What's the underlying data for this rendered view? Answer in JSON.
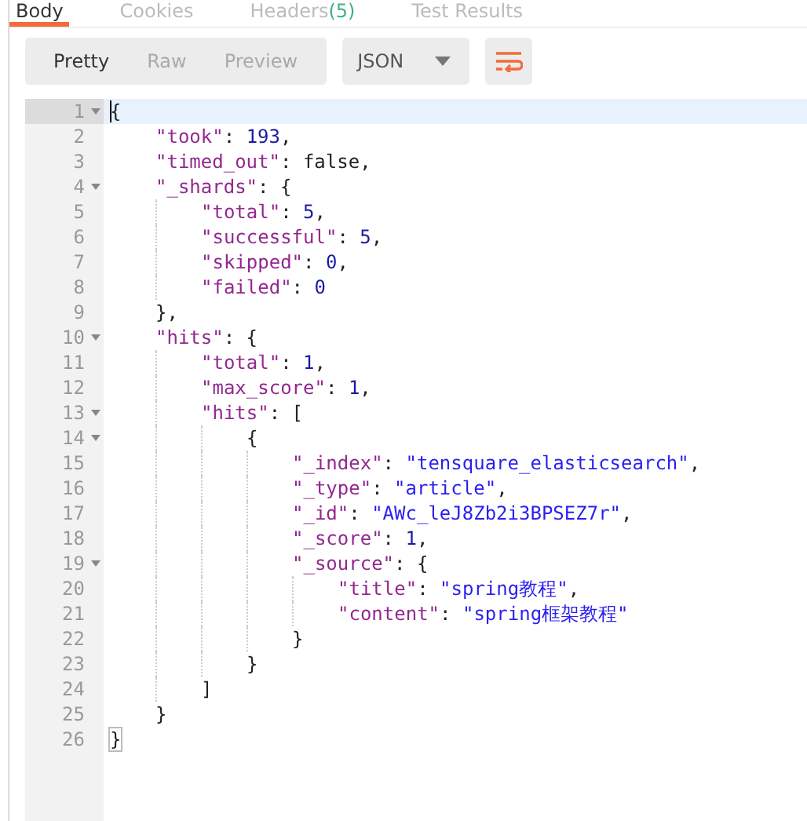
{
  "tabs": [
    {
      "label": "Body",
      "selected": true
    },
    {
      "label": "Cookies",
      "selected": false
    },
    {
      "label": "Headers",
      "count": "(5)",
      "selected": false
    },
    {
      "label": "Test Results",
      "selected": false
    }
  ],
  "view_modes": [
    {
      "label": "Pretty",
      "selected": true
    },
    {
      "label": "Raw",
      "selected": false
    },
    {
      "label": "Preview",
      "selected": false
    }
  ],
  "format_dropdown": {
    "value": "JSON"
  },
  "editor": {
    "lines": [
      {
        "number": "1",
        "fold": true,
        "active": true,
        "tokens": [
          {
            "kind": "punct",
            "text": "{"
          }
        ]
      },
      {
        "number": "2",
        "fold": false,
        "active": false,
        "tokens": [
          {
            "kind": "key",
            "text": "\"took\""
          },
          {
            "kind": "punct",
            "text": ": "
          },
          {
            "kind": "number",
            "text": "193"
          },
          {
            "kind": "punct",
            "text": ","
          }
        ]
      },
      {
        "number": "3",
        "fold": false,
        "active": false,
        "tokens": [
          {
            "kind": "key",
            "text": "\"timed_out\""
          },
          {
            "kind": "punct",
            "text": ": "
          },
          {
            "kind": "bool",
            "text": "false"
          },
          {
            "kind": "punct",
            "text": ","
          }
        ]
      },
      {
        "number": "4",
        "fold": true,
        "active": false,
        "tokens": [
          {
            "kind": "key",
            "text": "\"_shards\""
          },
          {
            "kind": "punct",
            "text": ": {"
          }
        ]
      },
      {
        "number": "5",
        "fold": false,
        "active": false,
        "tokens": [
          {
            "kind": "key",
            "text": "\"total\""
          },
          {
            "kind": "punct",
            "text": ": "
          },
          {
            "kind": "number",
            "text": "5"
          },
          {
            "kind": "punct",
            "text": ","
          }
        ]
      },
      {
        "number": "6",
        "fold": false,
        "active": false,
        "tokens": [
          {
            "kind": "key",
            "text": "\"successful\""
          },
          {
            "kind": "punct",
            "text": ": "
          },
          {
            "kind": "number",
            "text": "5"
          },
          {
            "kind": "punct",
            "text": ","
          }
        ]
      },
      {
        "number": "7",
        "fold": false,
        "active": false,
        "tokens": [
          {
            "kind": "key",
            "text": "\"skipped\""
          },
          {
            "kind": "punct",
            "text": ": "
          },
          {
            "kind": "number",
            "text": "0"
          },
          {
            "kind": "punct",
            "text": ","
          }
        ]
      },
      {
        "number": "8",
        "fold": false,
        "active": false,
        "tokens": [
          {
            "kind": "key",
            "text": "\"failed\""
          },
          {
            "kind": "punct",
            "text": ": "
          },
          {
            "kind": "number",
            "text": "0"
          }
        ]
      },
      {
        "number": "9",
        "fold": false,
        "active": false,
        "tokens": [
          {
            "kind": "punct",
            "text": "},"
          }
        ]
      },
      {
        "number": "10",
        "fold": true,
        "active": false,
        "tokens": [
          {
            "kind": "key",
            "text": "\"hits\""
          },
          {
            "kind": "punct",
            "text": ": {"
          }
        ]
      },
      {
        "number": "11",
        "fold": false,
        "active": false,
        "tokens": [
          {
            "kind": "key",
            "text": "\"total\""
          },
          {
            "kind": "punct",
            "text": ": "
          },
          {
            "kind": "number",
            "text": "1"
          },
          {
            "kind": "punct",
            "text": ","
          }
        ]
      },
      {
        "number": "12",
        "fold": false,
        "active": false,
        "tokens": [
          {
            "kind": "key",
            "text": "\"max_score\""
          },
          {
            "kind": "punct",
            "text": ": "
          },
          {
            "kind": "number",
            "text": "1"
          },
          {
            "kind": "punct",
            "text": ","
          }
        ]
      },
      {
        "number": "13",
        "fold": true,
        "active": false,
        "tokens": [
          {
            "kind": "key",
            "text": "\"hits\""
          },
          {
            "kind": "punct",
            "text": ": ["
          }
        ]
      },
      {
        "number": "14",
        "fold": true,
        "active": false,
        "tokens": [
          {
            "kind": "punct",
            "text": "{"
          }
        ]
      },
      {
        "number": "15",
        "fold": false,
        "active": false,
        "tokens": [
          {
            "kind": "key",
            "text": "\"_index\""
          },
          {
            "kind": "punct",
            "text": ": "
          },
          {
            "kind": "string",
            "text": "\"tensquare_elasticsearch\""
          },
          {
            "kind": "punct",
            "text": ","
          }
        ]
      },
      {
        "number": "16",
        "fold": false,
        "active": false,
        "tokens": [
          {
            "kind": "key",
            "text": "\"_type\""
          },
          {
            "kind": "punct",
            "text": ": "
          },
          {
            "kind": "string",
            "text": "\"article\""
          },
          {
            "kind": "punct",
            "text": ","
          }
        ]
      },
      {
        "number": "17",
        "fold": false,
        "active": false,
        "tokens": [
          {
            "kind": "key",
            "text": "\"_id\""
          },
          {
            "kind": "punct",
            "text": ": "
          },
          {
            "kind": "string",
            "text": "\"AWc_leJ8Zb2i3BPSEZ7r\""
          },
          {
            "kind": "punct",
            "text": ","
          }
        ]
      },
      {
        "number": "18",
        "fold": false,
        "active": false,
        "tokens": [
          {
            "kind": "key",
            "text": "\"_score\""
          },
          {
            "kind": "punct",
            "text": ": "
          },
          {
            "kind": "number",
            "text": "1"
          },
          {
            "kind": "punct",
            "text": ","
          }
        ]
      },
      {
        "number": "19",
        "fold": true,
        "active": false,
        "tokens": [
          {
            "kind": "key",
            "text": "\"_source\""
          },
          {
            "kind": "punct",
            "text": ": {"
          }
        ]
      },
      {
        "number": "20",
        "fold": false,
        "active": false,
        "tokens": [
          {
            "kind": "key",
            "text": "\"title\""
          },
          {
            "kind": "punct",
            "text": ": "
          },
          {
            "kind": "string",
            "text": "\"spring教程\""
          },
          {
            "kind": "punct",
            "text": ","
          }
        ]
      },
      {
        "number": "21",
        "fold": false,
        "active": false,
        "tokens": [
          {
            "kind": "key",
            "text": "\"content\""
          },
          {
            "kind": "punct",
            "text": ": "
          },
          {
            "kind": "string",
            "text": "\"spring框架教程\""
          }
        ]
      },
      {
        "number": "22",
        "fold": false,
        "active": false,
        "tokens": [
          {
            "kind": "punct",
            "text": "}"
          }
        ]
      },
      {
        "number": "23",
        "fold": false,
        "active": false,
        "tokens": [
          {
            "kind": "punct",
            "text": "}"
          }
        ]
      },
      {
        "number": "24",
        "fold": false,
        "active": false,
        "tokens": [
          {
            "kind": "punct",
            "text": "]"
          }
        ]
      },
      {
        "number": "25",
        "fold": false,
        "active": false,
        "tokens": [
          {
            "kind": "punct",
            "text": "}"
          }
        ]
      },
      {
        "number": "26",
        "fold": false,
        "active": false,
        "tokens": [
          {
            "kind": "match",
            "text": "}"
          }
        ]
      }
    ]
  }
}
